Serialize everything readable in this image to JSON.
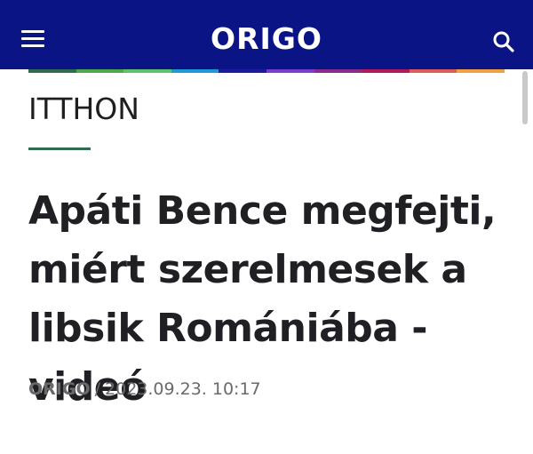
{
  "header": {
    "logo": "ORIGO",
    "menu_icon": "hamburger-menu-icon",
    "search_icon": "search-icon",
    "background": "#0a1485"
  },
  "stripe_colors": [
    "#2e6b4f",
    "#4ca84a",
    "#5cc36a",
    "#1f9ad6",
    "#1a1a9a",
    "#7a3ccc",
    "#8a2a8a",
    "#b01a5a",
    "#e05a5a",
    "#f0a040"
  ],
  "article": {
    "category": "ITTHON",
    "title": "Apáti Bence megfejti, miért szerelmesek a libsik Romániába - videó",
    "source": "ORIGO",
    "separator": "/",
    "date": "2023.09.23. 10:17"
  }
}
